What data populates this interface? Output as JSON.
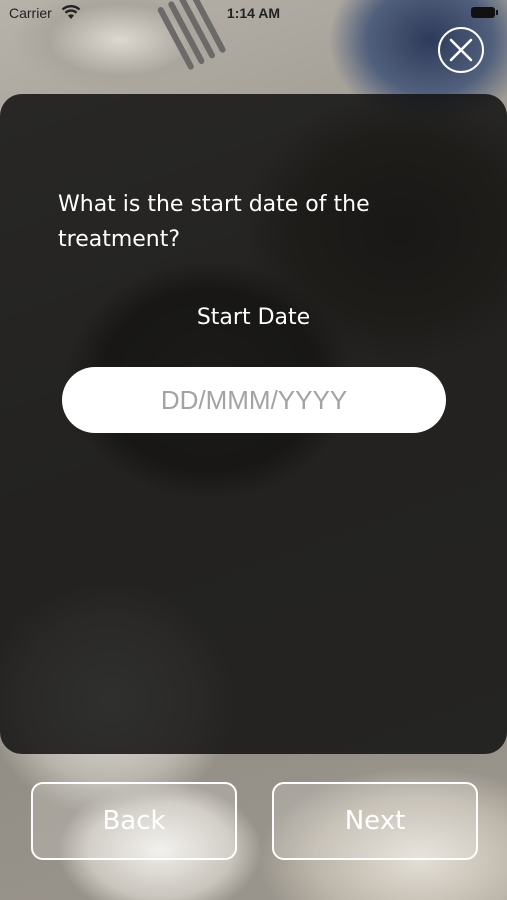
{
  "status_bar": {
    "carrier": "Carrier",
    "time": "1:14 AM"
  },
  "question": {
    "text": "What is the start date of the treatment?"
  },
  "start_date": {
    "label": "Start Date",
    "placeholder": "DD/MMM/YYYY",
    "value": ""
  },
  "nav": {
    "back_label": "Back",
    "next_label": "Next"
  },
  "icons": {
    "close": "close-icon",
    "wifi": "wifi-icon",
    "battery": "battery-icon"
  }
}
